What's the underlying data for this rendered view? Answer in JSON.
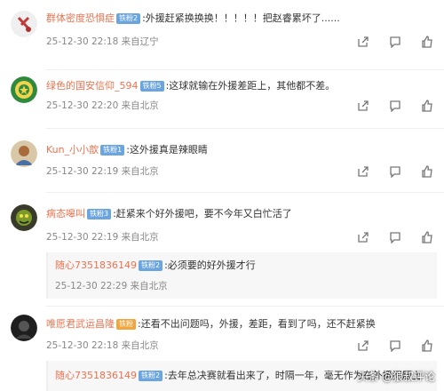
{
  "comments": [
    {
      "username": "群体密度恐惧症",
      "badge": "铁粉2",
      "text": ":外援赶紧换换换！！！！！把赵睿累坏了......",
      "meta": "25-12-30 22:18 来自辽宁"
    },
    {
      "username": "绿色的国安信仰_594",
      "badge": "铁粉5",
      "text": ":这球就输在外援差距上，其他都不差。",
      "meta": "25-12-30 22:20 来自北京"
    },
    {
      "username": "Kun_小小歆",
      "badge": "铁粉1",
      "text": ":这外援真是辣眼睛",
      "meta": "25-12-30 22:19 来自北京"
    },
    {
      "username": "病态嗥叫",
      "badge": "铁粉3",
      "text": ":赶紧来个好外援吧，要不今年又白忙活了",
      "meta": "25-12-30 22:19 来自北京",
      "reply": {
        "username": "随心7351836149",
        "badge": "铁粉2",
        "text": ":必须要的好外援才行",
        "meta": "25-12-30 22:29 来自北京"
      }
    },
    {
      "username": "唯愿君武运昌隆",
      "badge": "铁粉",
      "text": ":还看不出问题吗，外援，差距，看到了吗，还不赶紧换",
      "meta": "25-12-30 22:18 来自北京",
      "reply": {
        "username": "随心7351836149",
        "badge": "铁粉2",
        "text": ":去年总决赛就看出来了，时隔一年，毫无作为在外援问题上"
      }
    }
  ],
  "watermark": "头条 @狼叔评论",
  "colors": {
    "username": "#eb7350",
    "badge": "#6aa5e0",
    "badge_gold": "#f3a43b",
    "meta": "#888888",
    "reply_bg": "#f7f7f7"
  },
  "icons": [
    "share-icon",
    "comment-icon",
    "like-icon"
  ]
}
